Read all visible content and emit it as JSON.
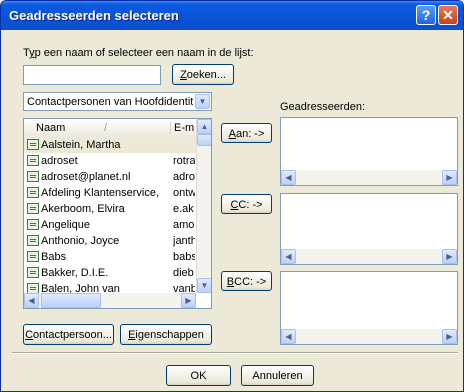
{
  "window": {
    "title": "Geadresseerden selecteren",
    "help_glyph": "?",
    "close_glyph": "✕"
  },
  "search": {
    "label_prefix": "T",
    "label_accel": "y",
    "label_rest": "p een naam of selecteer een naam in de lijst:",
    "value": "",
    "button_accel": "Z",
    "button_rest": "oeken..."
  },
  "address_book": {
    "selected": "Contactpersonen van Hoofdidentiteit"
  },
  "contacts": {
    "columns": {
      "name": "Naam",
      "sort_glyph": "/",
      "email": "E-m"
    },
    "rows": [
      {
        "name": "Aalstein, Martha",
        "email": ""
      },
      {
        "name": "adroset",
        "email": "rotra"
      },
      {
        "name": "adroset@planet.nl",
        "email": "adro:"
      },
      {
        "name": "Afdeling Klantenservice, ...",
        "email": "ontw"
      },
      {
        "name": "Akerboom, Elvira",
        "email": "e.ak"
      },
      {
        "name": "Angelique",
        "email": "amor"
      },
      {
        "name": "Anthonio, Joyce",
        "email": "janth"
      },
      {
        "name": "Babs",
        "email": "babs"
      },
      {
        "name": "Bakker, D.I.E.",
        "email": "dieb"
      },
      {
        "name": "Balen, John van",
        "email": "vanb"
      }
    ]
  },
  "recipients": {
    "label": "Geadresseerden:"
  },
  "buttons": {
    "to_accel": "A",
    "to_rest": "an: ->",
    "cc_accel": "C",
    "cc_rest": "C: ->",
    "bcc_accel": "B",
    "bcc_rest": "CC: ->",
    "contact_accel": "C",
    "contact_rest": "ontactpersoon...",
    "props_accel": "E",
    "props_rest": "igenschappen",
    "ok": "OK",
    "cancel": "Annuleren"
  },
  "colors": {
    "title_bar": "#0a53d6",
    "dialog_bg": "#ece9d8"
  }
}
